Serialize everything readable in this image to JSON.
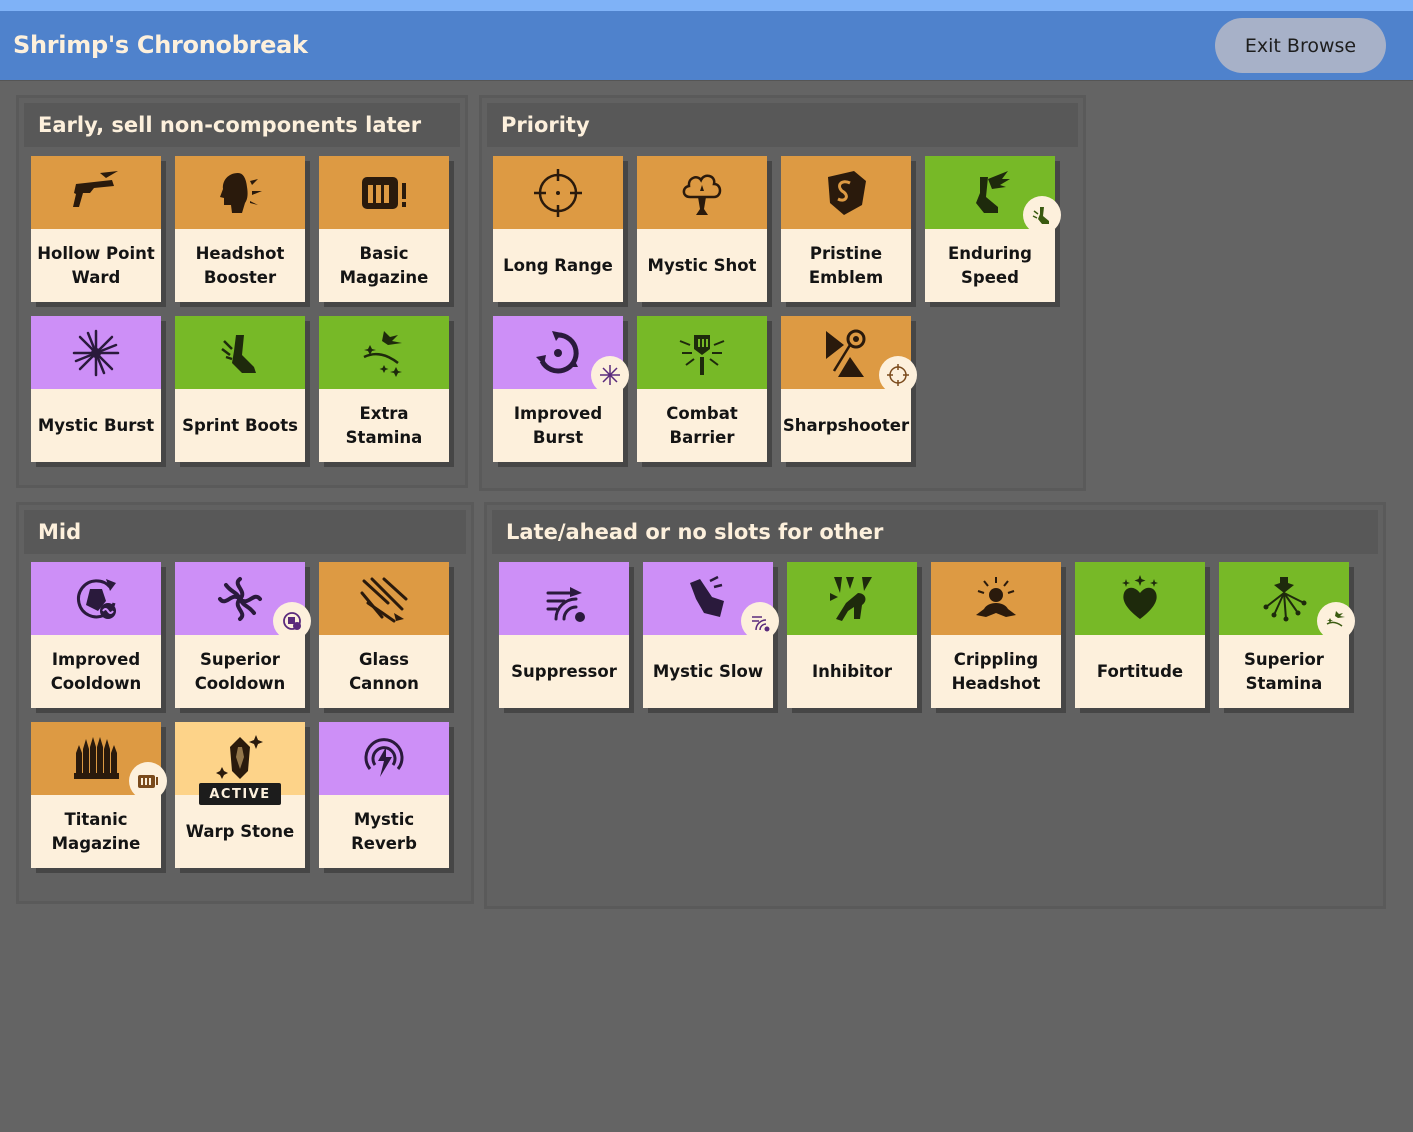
{
  "header": {
    "title": "Shrimp's Chronobreak",
    "exit_label": "Exit Browse"
  },
  "colors": {
    "orange": "#dd9a43",
    "purple": "#cd8ff7",
    "green": "#77b927",
    "gold": "#fdd389",
    "card_bg": "#fdf0dc",
    "header_bg": "#4f82cc"
  },
  "groups": {
    "early": {
      "title": "Early, sell non-components later",
      "items": [
        {
          "name": "Hollow Point Ward",
          "color": "orange",
          "icon": "pistol-icon"
        },
        {
          "name": "Headshot Booster",
          "color": "orange",
          "icon": "head-burst-icon"
        },
        {
          "name": "Basic Magazine",
          "color": "orange",
          "icon": "magazine-icon"
        },
        {
          "name": "Mystic Burst",
          "color": "purple",
          "icon": "burst-star-icon"
        },
        {
          "name": "Sprint Boots",
          "color": "green",
          "icon": "boot-icon"
        },
        {
          "name": "Extra Stamina",
          "color": "green",
          "icon": "stamina-icon"
        }
      ]
    },
    "priority": {
      "title": "Priority",
      "items": [
        {
          "name": "Long Range",
          "color": "orange",
          "icon": "crosshair-icon"
        },
        {
          "name": "Mystic Shot",
          "color": "orange",
          "icon": "mystic-cloud-icon"
        },
        {
          "name": "Pristine Emblem",
          "color": "orange",
          "icon": "shield-emblem-icon"
        },
        {
          "name": "Enduring Speed",
          "color": "green",
          "icon": "winged-boot-icon"
        },
        {
          "name": "Improved Burst",
          "color": "purple",
          "icon": "swirl-burst-icon"
        },
        {
          "name": "Combat Barrier",
          "color": "green",
          "icon": "barrier-icon"
        },
        {
          "name": "Sharpshooter",
          "color": "orange",
          "icon": "sharpshooter-icon"
        }
      ]
    },
    "mid": {
      "title": "Mid",
      "items": [
        {
          "name": "Improved Cooldown",
          "color": "purple",
          "icon": "cooldown-icon"
        },
        {
          "name": "Superior Cooldown",
          "color": "purple",
          "icon": "vortex-icon"
        },
        {
          "name": "Glass Cannon",
          "color": "orange",
          "icon": "glass-shards-icon"
        },
        {
          "name": "Titanic Magazine",
          "color": "orange",
          "icon": "bullets-icon"
        },
        {
          "name": "Warp Stone",
          "color": "gold",
          "icon": "crystal-icon",
          "tag": "ACTIVE"
        },
        {
          "name": "Mystic Reverb",
          "color": "purple",
          "icon": "reverb-icon"
        }
      ]
    },
    "late": {
      "title": "Late/ahead or no slots for other",
      "items": [
        {
          "name": "Suppressor",
          "color": "purple",
          "icon": "suppressor-icon"
        },
        {
          "name": "Mystic Slow",
          "color": "purple",
          "icon": "slow-hand-icon"
        },
        {
          "name": "Inhibitor",
          "color": "green",
          "icon": "inhibitor-icon"
        },
        {
          "name": "Crippling Headshot",
          "color": "orange",
          "icon": "crippling-icon"
        },
        {
          "name": "Fortitude",
          "color": "green",
          "icon": "heart-icon"
        },
        {
          "name": "Superior Stamina",
          "color": "green",
          "icon": "superior-stamina-icon"
        }
      ]
    }
  }
}
